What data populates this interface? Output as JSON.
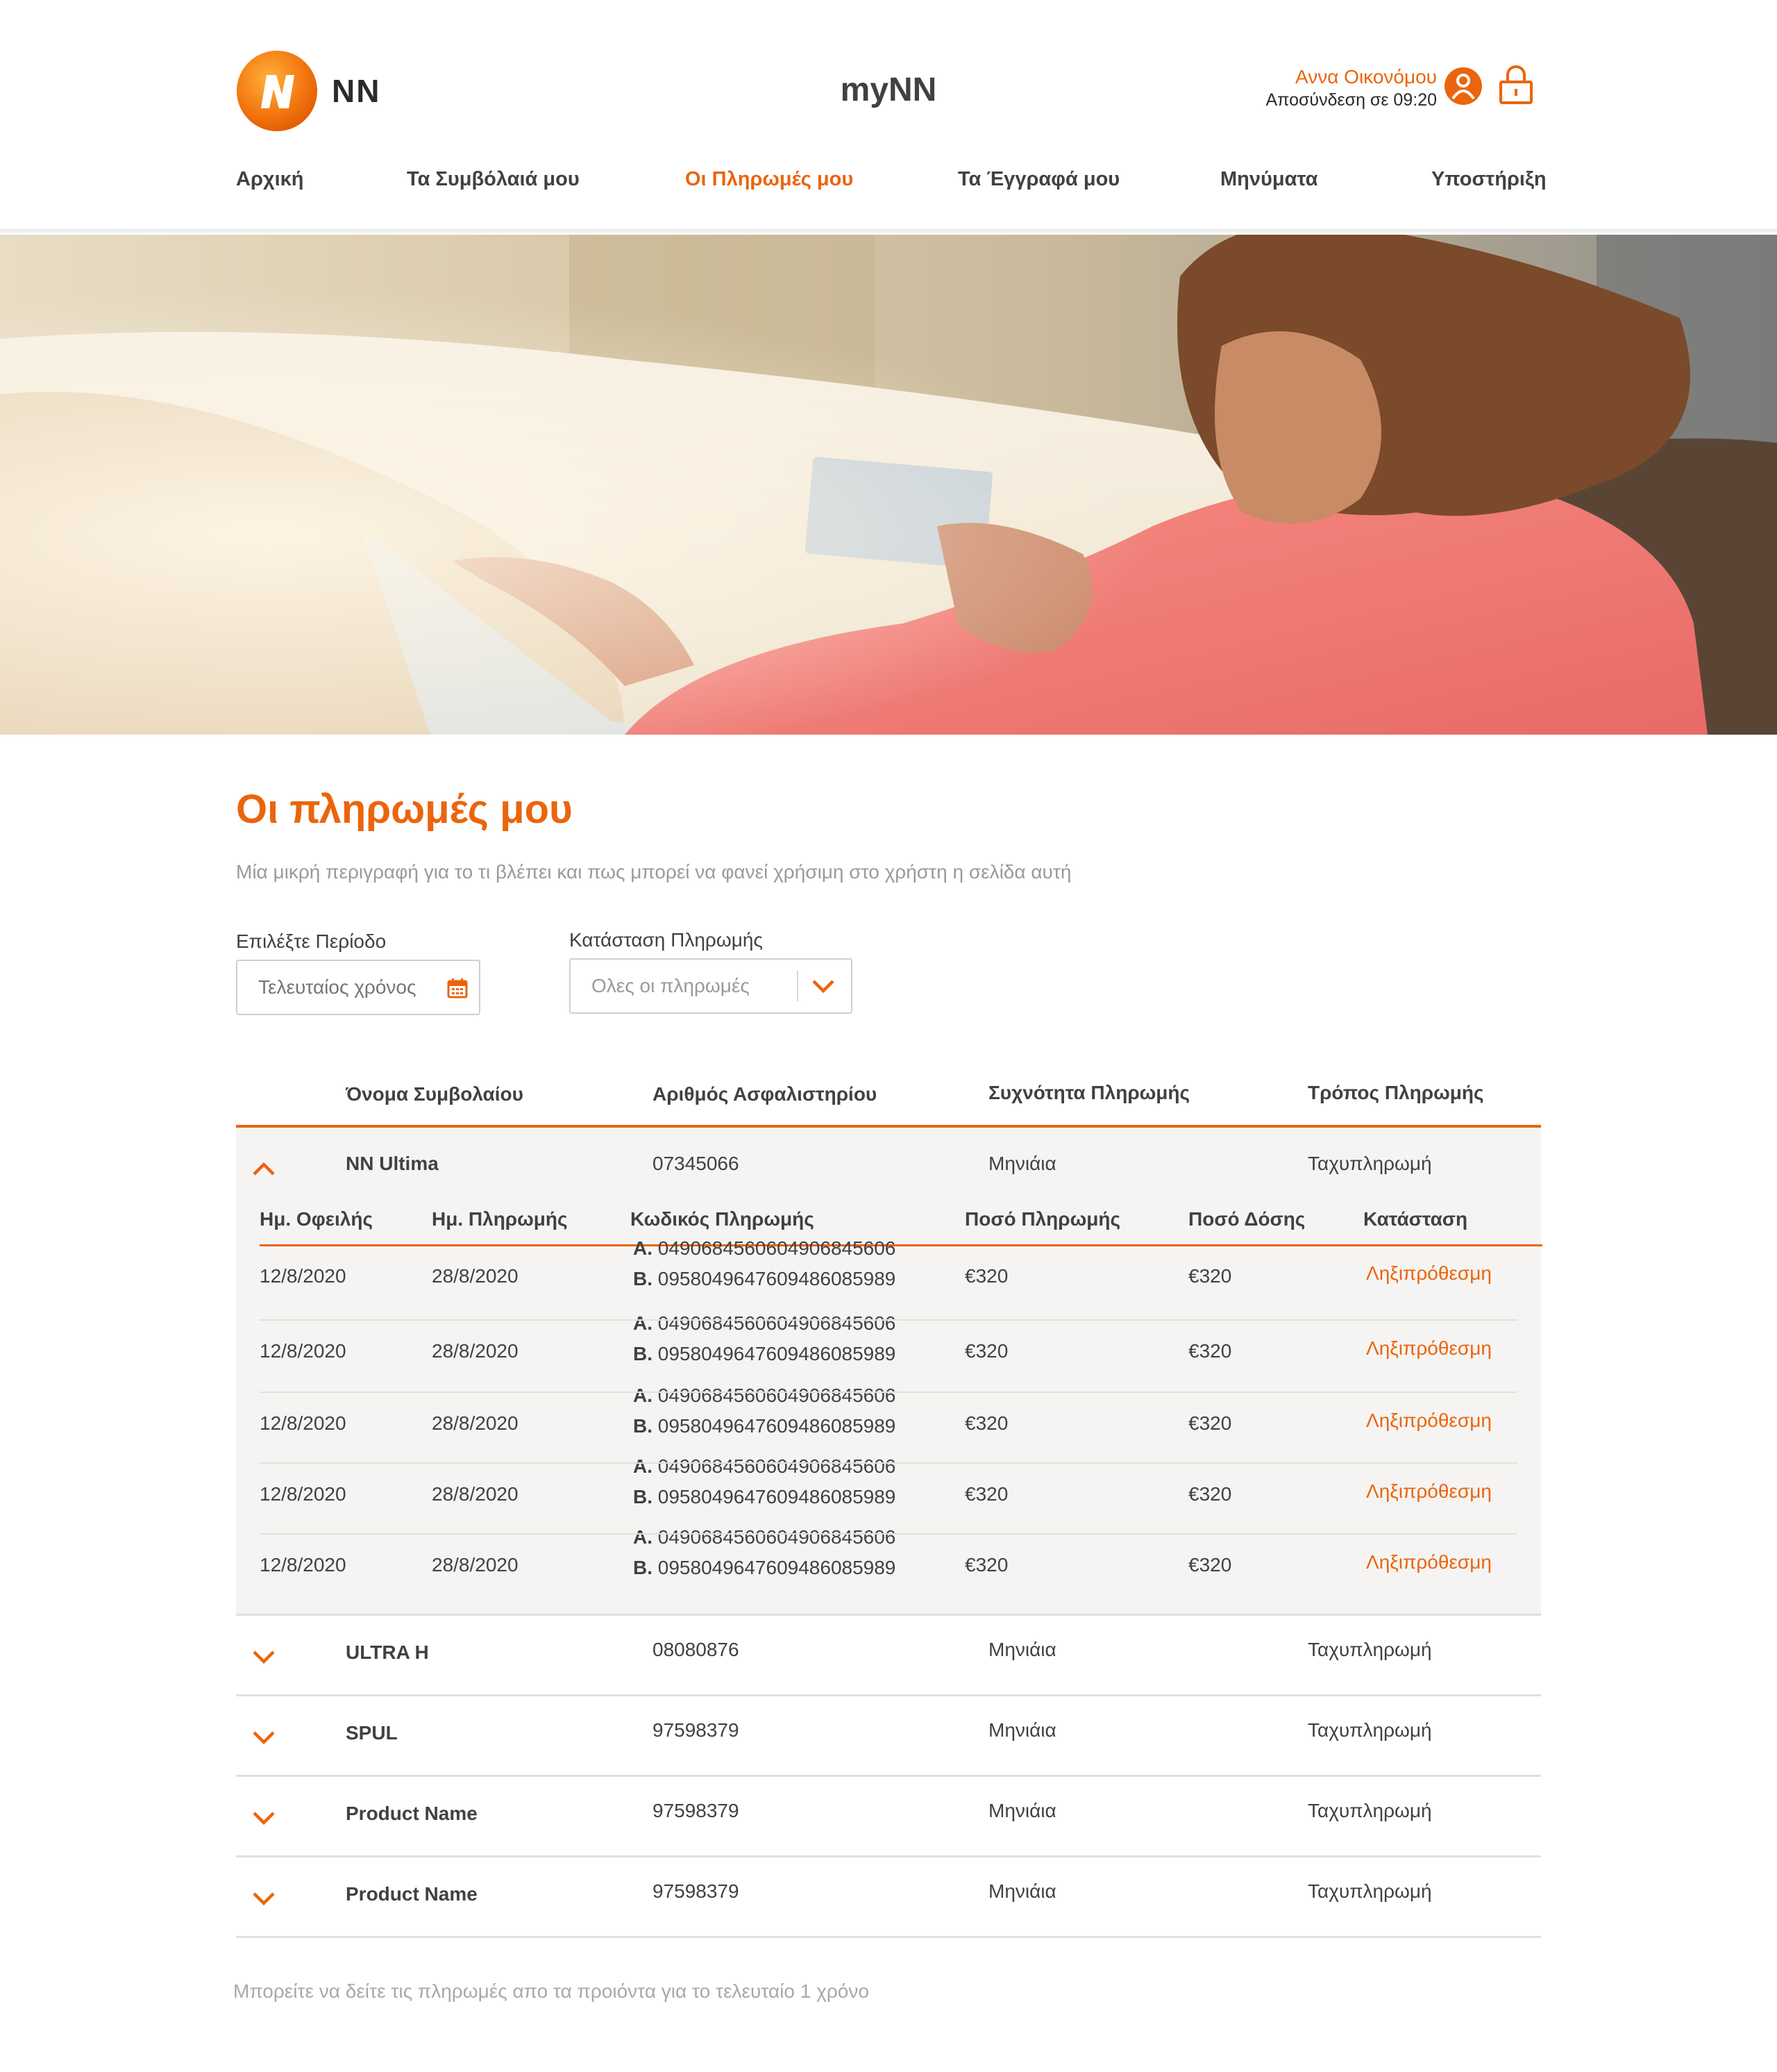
{
  "brand": {
    "logo_text": "NN",
    "app_title": "myNN",
    "accent_color": "#ea650d"
  },
  "user": {
    "name": "Αννα Οικονόμου",
    "logout_timer": "Αποσύνδεση σε 09:20"
  },
  "nav": {
    "items": [
      {
        "label": "Αρχική"
      },
      {
        "label": "Τα Συμβόλαιά μου"
      },
      {
        "label": "Οι Πληρωμές μου"
      },
      {
        "label": "Τα Έγγραφά μου"
      },
      {
        "label": "Μηνύματα"
      },
      {
        "label": "Υποστήριξη"
      }
    ],
    "active_index": 2
  },
  "page": {
    "title": "Οι πληρωμές μου",
    "description": "Μία μικρή περιγραφή για το τι βλέπει και πως μπορεί να φανεί χρήσιμη στο χρήστη η σελίδα αυτή",
    "footer_note": "Μπορείτε να δείτε τις πληρωμές απο τα προιόντα για το τελευταίο 1 χρόνο"
  },
  "filters": {
    "period": {
      "label": "Επιλέξτε Περίοδο",
      "placeholder": "Τελευταίος χρόνος",
      "icon": "calendar-icon"
    },
    "status": {
      "label": "Κατάσταση Πληρωμής",
      "value": "Ολες οι πληρωμές",
      "icon": "chevron-down-icon"
    }
  },
  "policies_table": {
    "headers": {
      "name": "Όνομα Συμβολαίου",
      "number": "Αριθμός Ασφαλιστηρίου",
      "frequency": "Συχνότητα Πληρωμής",
      "method": "Τρόπος Πληρωμής"
    },
    "rows": [
      {
        "name": "NN Ultima",
        "number": "07345066",
        "frequency": "Μηνιάια",
        "method": "Ταχυπληρωμή",
        "expanded": true
      },
      {
        "name": "ULTRA H",
        "number": "08080876",
        "frequency": "Μηνιάια",
        "method": "Ταχυπληρωμή",
        "expanded": false
      },
      {
        "name": "SPUL",
        "number": "97598379",
        "frequency": "Μηνιάια",
        "method": "Ταχυπληρωμή",
        "expanded": false
      },
      {
        "name": "Product Name",
        "number": "97598379",
        "frequency": "Μηνιάια",
        "method": "Ταχυπληρωμή",
        "expanded": false
      },
      {
        "name": "Product Name",
        "number": "97598379",
        "frequency": "Μηνιάια",
        "method": "Ταχυπληρωμή",
        "expanded": false
      }
    ]
  },
  "payments_table": {
    "headers": {
      "due_date": "Ημ. Οφειλής",
      "pay_date": "Ημ. Πληρωμής",
      "code": "Κωδικός Πληρωμής",
      "amount": "Ποσό Πληρωμής",
      "installment": "Ποσό Δόσης",
      "status": "Κατάσταση"
    },
    "rows": [
      {
        "due_date": "12/8/2020",
        "pay_date": "28/8/2020",
        "code_a_label": "A.",
        "code_a": "0490684560604906845606",
        "code_b_label": "B.",
        "code_b": "0958049647609486085989",
        "amount": "€320",
        "installment": "€320",
        "status": "Ληξιπρόθεσμη"
      },
      {
        "due_date": "12/8/2020",
        "pay_date": "28/8/2020",
        "code_a_label": "A.",
        "code_a": "0490684560604906845606",
        "code_b_label": "B.",
        "code_b": "0958049647609486085989",
        "amount": "€320",
        "installment": "€320",
        "status": "Ληξιπρόθεσμη"
      },
      {
        "due_date": "12/8/2020",
        "pay_date": "28/8/2020",
        "code_a_label": "A.",
        "code_a": "0490684560604906845606",
        "code_b_label": "B.",
        "code_b": "0958049647609486085989",
        "amount": "€320",
        "installment": "€320",
        "status": "Ληξιπρόθεσμη"
      },
      {
        "due_date": "12/8/2020",
        "pay_date": "28/8/2020",
        "code_a_label": "A.",
        "code_a": "0490684560604906845606",
        "code_b_label": "B.",
        "code_b": "0958049647609486085989",
        "amount": "€320",
        "installment": "€320",
        "status": "Ληξιπρόθεσμη"
      },
      {
        "due_date": "12/8/2020",
        "pay_date": "28/8/2020",
        "code_a_label": "A.",
        "code_a": "0490684560604906845606",
        "code_b_label": "B.",
        "code_b": "0958049647609486085989",
        "amount": "€320",
        "installment": "€320",
        "status": "Ληξιπρόθεσμη"
      }
    ]
  }
}
